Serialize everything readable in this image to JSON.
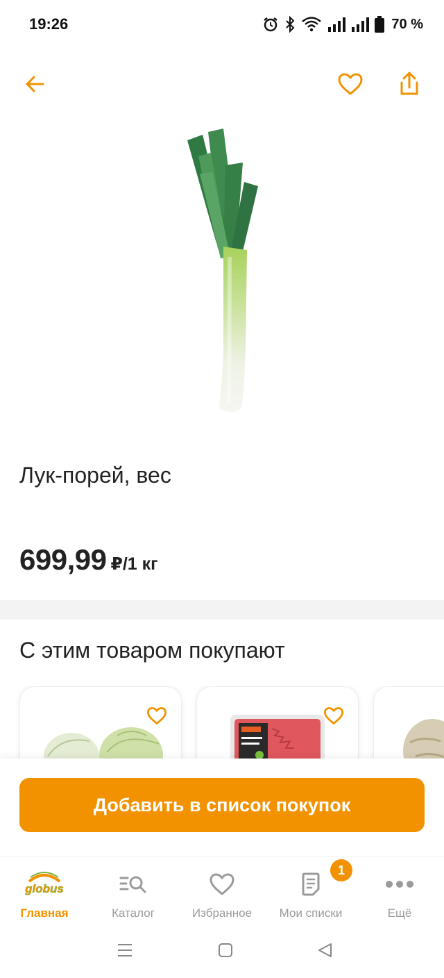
{
  "status_bar": {
    "time": "19:26",
    "battery_percent": "70 %"
  },
  "product": {
    "title": "Лук-порей, вес",
    "price": "699,99",
    "unit": "₽/1 кг",
    "image_icon": "leek-image"
  },
  "recommendations": {
    "title": "С этим товаром покупают",
    "items": [
      {
        "image_icon": "kohlrabi-image"
      },
      {
        "image_icon": "ground-beef-pack-image"
      },
      {
        "image_icon": "celery-root-image"
      }
    ]
  },
  "actions": {
    "add_to_list": "Добавить в список покупок"
  },
  "tabs": [
    {
      "label": "Главная",
      "icon": "globus-logo-icon",
      "active": true
    },
    {
      "label": "Каталог",
      "icon": "catalog-search-icon",
      "active": false
    },
    {
      "label": "Избранное",
      "icon": "heart-icon",
      "active": false
    },
    {
      "label": "Мои списки",
      "icon": "list-icon",
      "active": false,
      "badge": "1"
    },
    {
      "label": "Ещё",
      "icon": "more-dots-icon",
      "active": false
    }
  ],
  "colors": {
    "accent": "#f39200",
    "text": "#222222",
    "muted": "#9a9a9a"
  }
}
